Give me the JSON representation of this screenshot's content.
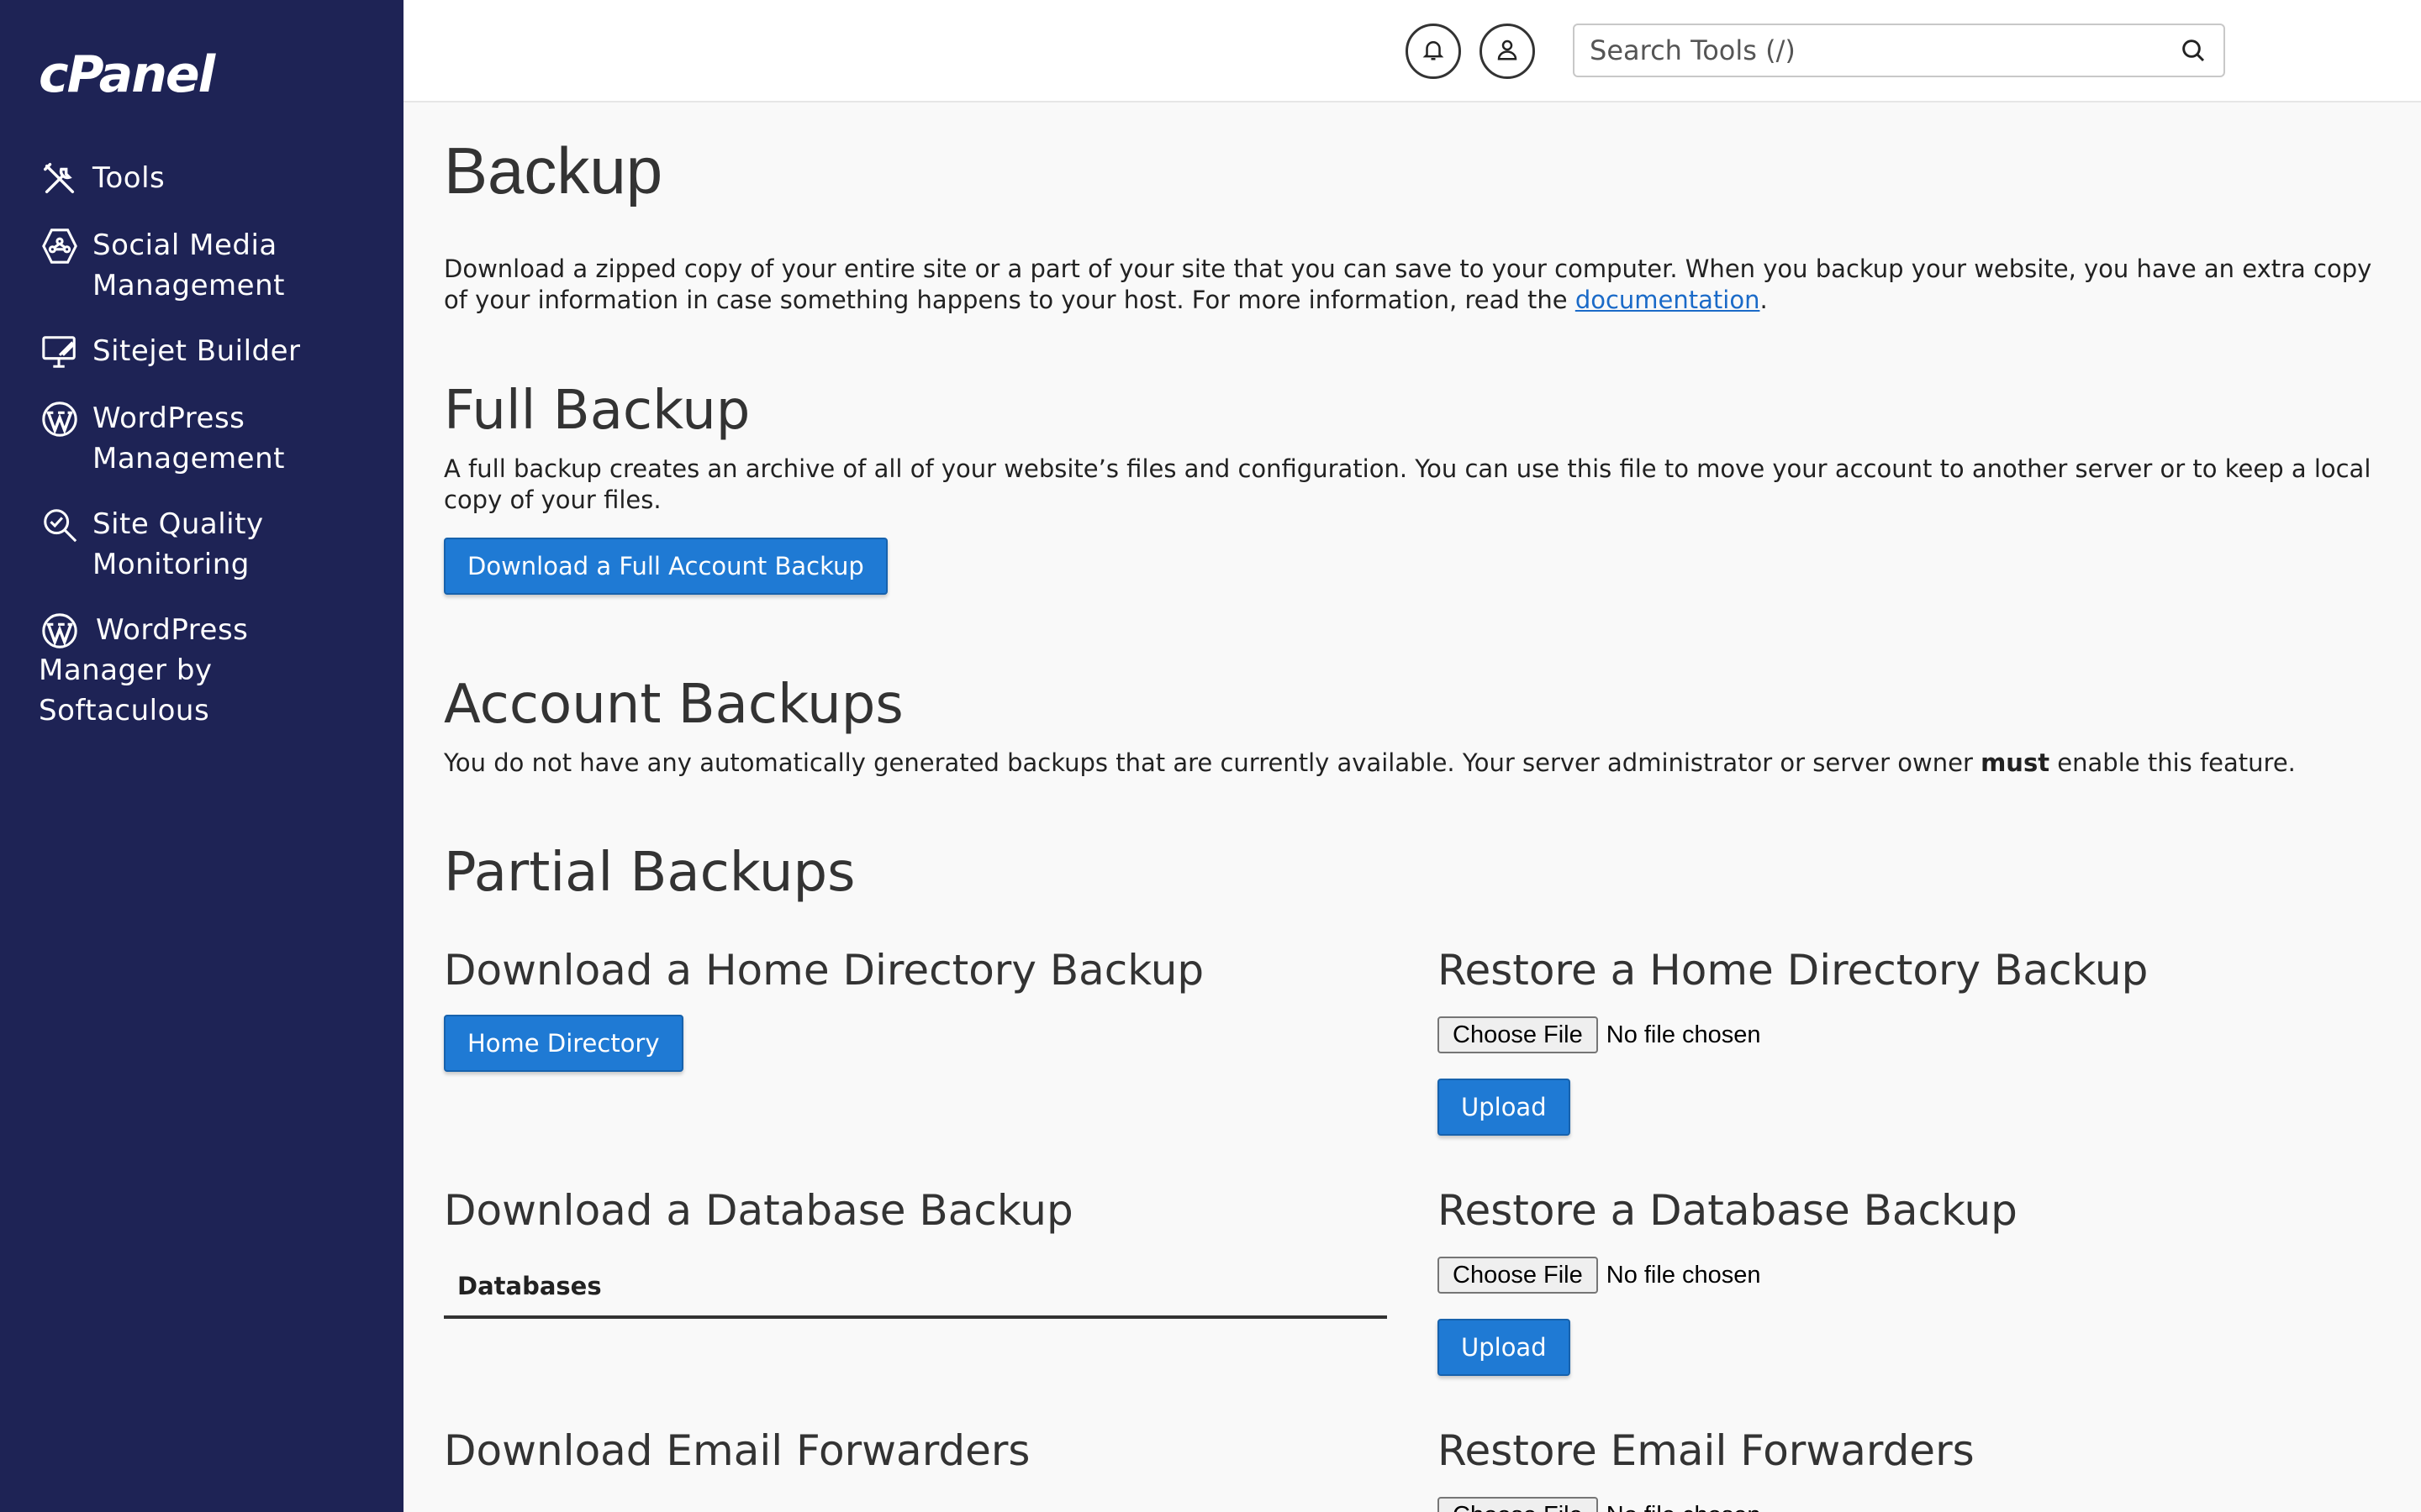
{
  "sidebar": {
    "logo": "cPanel",
    "items": [
      {
        "label": "Tools",
        "icon": "tools-icon"
      },
      {
        "label": "Social Media Management",
        "icon": "social-media-icon"
      },
      {
        "label": "Sitejet Builder",
        "icon": "sitejet-icon"
      },
      {
        "label": "WordPress Management",
        "icon": "wordpress-icon"
      },
      {
        "label": "Site Quality Monitoring",
        "icon": "site-quality-icon"
      },
      {
        "label": "WordPress Manager by Softaculous",
        "icon": "wordpress-icon"
      }
    ]
  },
  "header": {
    "search_placeholder": "Search Tools (/)"
  },
  "page": {
    "title": "Backup",
    "intro_before_link": "Download a zipped copy of your entire site or a part of your site that you can save to your computer. When you backup your website, you have an extra copy of your information in case something happens to your host. For more information, read the ",
    "intro_link": "documentation",
    "intro_after_link": "."
  },
  "full_backup": {
    "heading": "Full Backup",
    "description": "A full backup creates an archive of all of your website’s files and configuration. You can use this file to move your account to another server or to keep a local copy of your files.",
    "button": "Download a Full Account Backup"
  },
  "account_backups": {
    "heading": "Account Backups",
    "text_before": "You do not have any automatically generated backups that are currently available. Your server administrator or server owner ",
    "text_bold": "must",
    "text_after": " enable this feature."
  },
  "partial_backups": {
    "heading": "Partial Backups",
    "home_download_heading": "Download a Home Directory Backup",
    "home_download_button": "Home Directory",
    "home_restore_heading": "Restore a Home Directory Backup",
    "db_download_heading": "Download a Database Backup",
    "db_table_header": "Databases",
    "db_restore_heading": "Restore a Database Backup",
    "email_download_heading": "Download Email Forwarders",
    "email_restore_heading": "Restore Email Forwarders",
    "choose_file_label": "Choose File",
    "no_file_text": "No file chosen",
    "upload_label": "Upload"
  },
  "colors": {
    "sidebar_bg": "#1e2355",
    "button_bg": "#1f7ad4",
    "link": "#1a6ac8"
  }
}
